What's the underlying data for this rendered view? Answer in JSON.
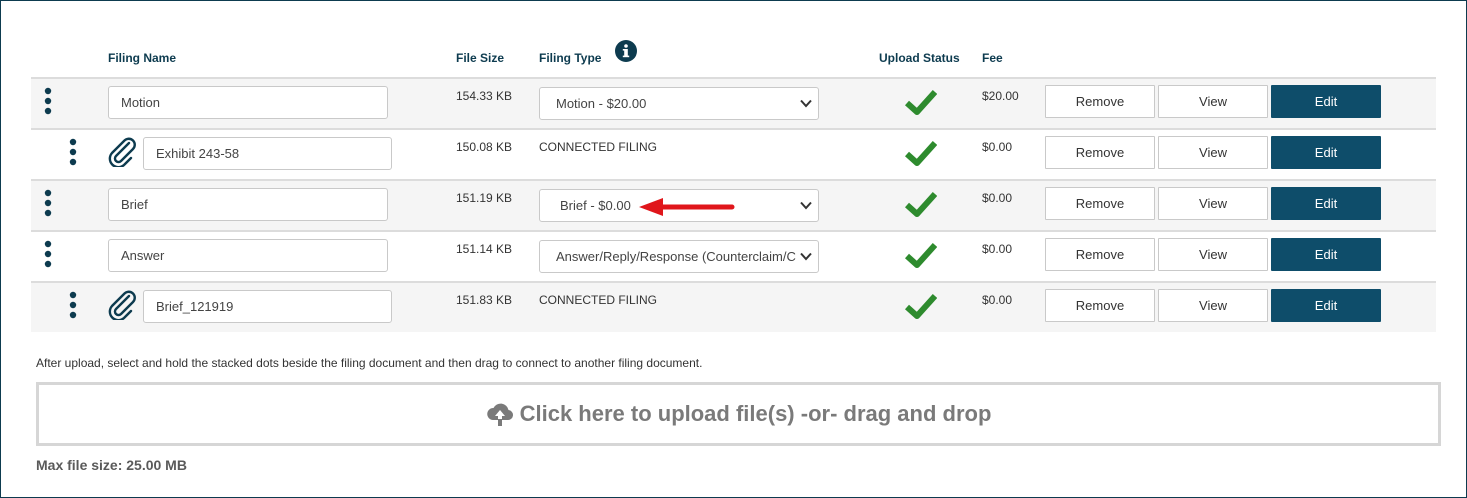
{
  "table": {
    "headers": {
      "filing_name": "Filing Name",
      "file_size": "File Size",
      "filing_type": "Filing Type",
      "upload_status": "Upload Status",
      "fee": "Fee"
    },
    "rows": [
      {
        "name": "Motion",
        "size": "154.33 KB",
        "type": "Motion - $20.00",
        "type_is_select": true,
        "connected": false,
        "status": "uploaded",
        "fee": "$20.00"
      },
      {
        "name": "Exhibit 243-58",
        "size": "150.08 KB",
        "type": "CONNECTED FILING",
        "type_is_select": false,
        "connected": true,
        "status": "uploaded",
        "fee": "$0.00"
      },
      {
        "name": "Brief",
        "size": "151.19 KB",
        "type": "Brief - $0.00",
        "type_is_select": true,
        "connected": false,
        "status": "uploaded",
        "fee": "$0.00"
      },
      {
        "name": "Answer",
        "size": "151.14 KB",
        "type": "Answer/Reply/Response (Counterclaim/C",
        "type_is_select": true,
        "connected": false,
        "status": "uploaded",
        "fee": "$0.00"
      },
      {
        "name": "Brief_121919",
        "size": "151.83 KB",
        "type": "CONNECTED FILING",
        "type_is_select": false,
        "connected": true,
        "status": "uploaded",
        "fee": "$0.00"
      }
    ],
    "actions": {
      "remove": "Remove",
      "view": "View",
      "edit": "Edit"
    }
  },
  "help_text": "After upload, select and hold the stacked dots beside the filing document and then drag to connect to another filing document.",
  "upload": {
    "label": "Click here to upload file(s) -or- drag and drop"
  },
  "max_file_size": "Max file size: 25.00 MB",
  "colors": {
    "navy": "#0d3b4f",
    "edit_button": "#0e4d6a",
    "check": "#2e8b2e",
    "arrow": "#e0161b"
  },
  "icons": [
    "info-icon",
    "drag-handle-icon",
    "paperclip-icon",
    "chevron-down-icon",
    "checkmark-icon",
    "cloud-upload-icon",
    "red-arrow-icon"
  ]
}
